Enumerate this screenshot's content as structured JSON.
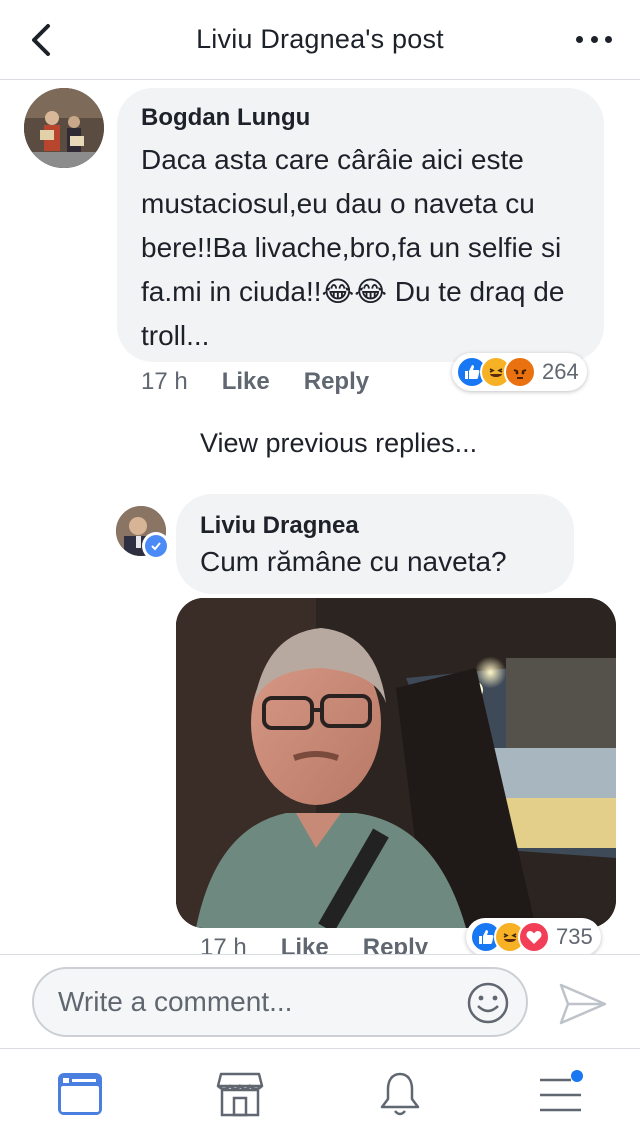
{
  "header": {
    "title": "Liviu Dragnea's post",
    "back_icon": "chevron-left-icon",
    "more_icon": "more-dots-icon"
  },
  "comments": [
    {
      "author": "Bogdan Lungu",
      "text": "Daca asta care cârâie aici este mustaciosul,eu dau o naveta cu bere!!Ba livache,bro,fa un selfie si fa.mi in ciuda!!😂😂 Du te draq de troll...",
      "time": "17 h",
      "like_label": "Like",
      "reply_label": "Reply",
      "reactions": [
        "like",
        "haha",
        "angry"
      ],
      "reaction_count": "264"
    }
  ],
  "view_previous_label": "View previous replies...",
  "reply": {
    "author": "Liviu Dragnea",
    "text": "Cum rămâne cu naveta?",
    "verified": true,
    "time": "17 h",
    "like_label": "Like",
    "reply_label": "Reply",
    "reactions": [
      "like",
      "haha",
      "love"
    ],
    "reaction_count": "735"
  },
  "composer": {
    "placeholder": "Write a comment...",
    "emoji_icon": "smiley-icon",
    "send_icon": "send-icon"
  },
  "bottom_nav": [
    "news-feed-icon",
    "marketplace-icon",
    "notifications-bell-icon",
    "menu-icon"
  ],
  "colors": {
    "accent": "#4c8bf5",
    "bubble": "#f2f3f5",
    "muted_text": "#606770",
    "like": "#1877f2",
    "haha": "#f7b125",
    "angry": "#e9710f",
    "love": "#f33e58"
  }
}
